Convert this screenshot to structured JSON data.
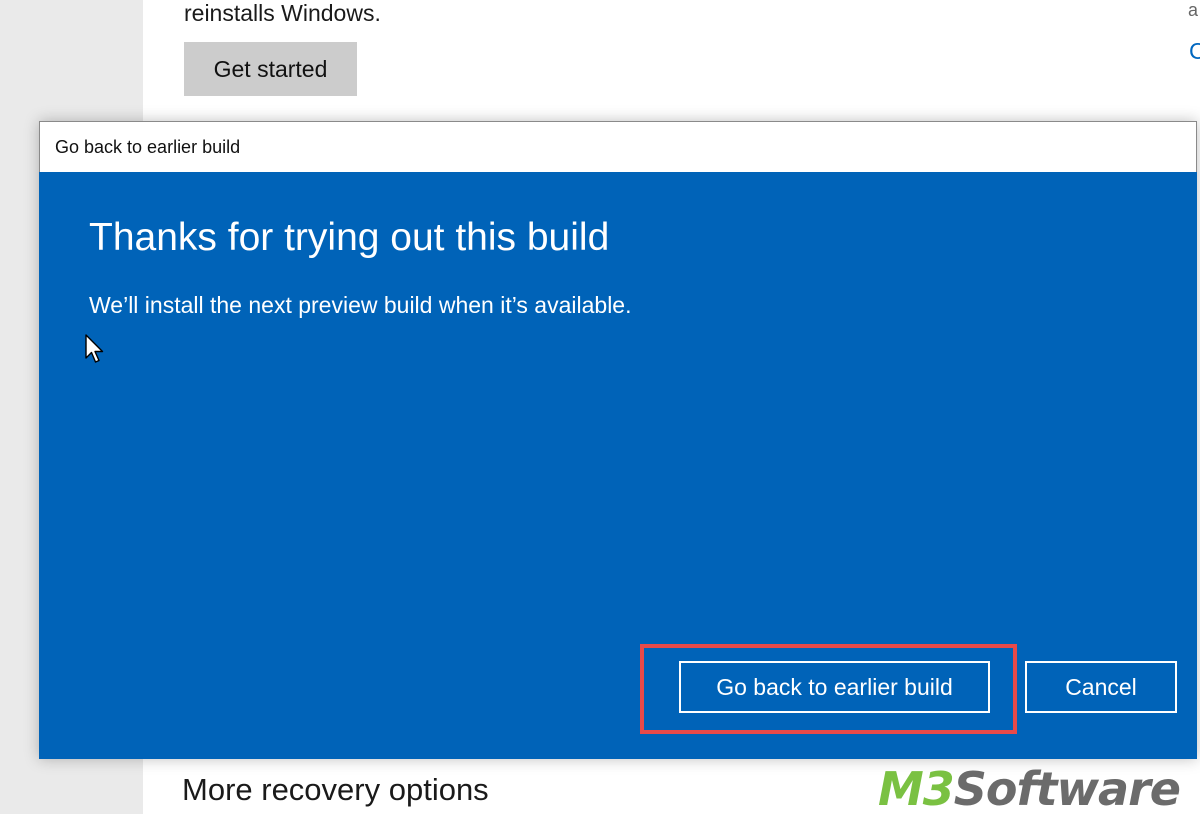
{
  "background": {
    "description_text": "reinstalls Windows.",
    "get_started_label": "Get started",
    "edge_char_top": "a",
    "edge_char_link": "C",
    "more_recovery_heading": "More recovery options"
  },
  "dialog": {
    "title": "Go back to earlier build",
    "heading": "Thanks for trying out this build",
    "message": "We’ll install the next preview build when it’s available.",
    "primary_button_label": "Go back to earlier build",
    "cancel_button_label": "Cancel"
  },
  "watermark": {
    "brand_prefix": "M3",
    "brand_suffix": "Software"
  },
  "colors": {
    "dialog_body": "#0063b8",
    "highlight_box": "#e84a4a",
    "watermark_green": "#7ac142",
    "watermark_gray": "#6b6b6b"
  },
  "icons": {
    "pointer": "mouse-pointer-icon"
  }
}
